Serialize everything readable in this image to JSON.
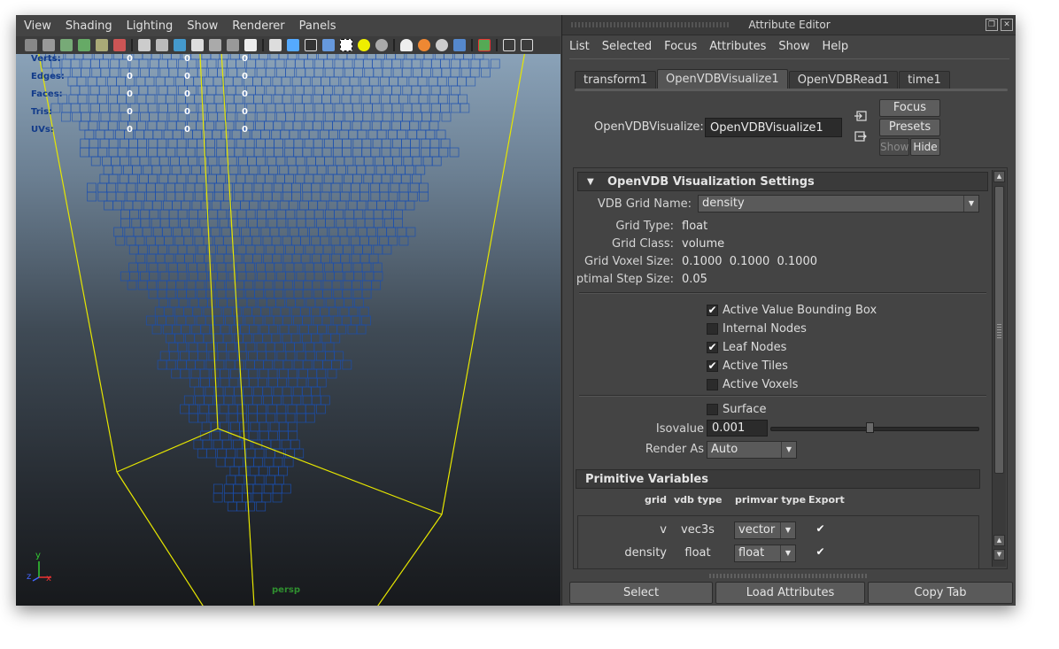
{
  "viewport": {
    "menu": [
      "View",
      "Shading",
      "Lighting",
      "Show",
      "Renderer",
      "Panels"
    ],
    "hud": [
      {
        "label": "Verts:",
        "values": [
          "0",
          "0",
          "0"
        ]
      },
      {
        "label": "Edges:",
        "values": [
          "0",
          "0",
          "0"
        ]
      },
      {
        "label": "Faces:",
        "values": [
          "0",
          "0",
          "0"
        ]
      },
      {
        "label": "Tris:",
        "values": [
          "0",
          "0",
          "0"
        ]
      },
      {
        "label": "UVs:",
        "values": [
          "0",
          "0",
          "0"
        ]
      }
    ],
    "camera_label": "persp",
    "axis": {
      "y": "y",
      "x": "x",
      "z": "z"
    }
  },
  "editor": {
    "title": "Attribute Editor",
    "menu": [
      "List",
      "Selected",
      "Focus",
      "Attributes",
      "Show",
      "Help"
    ],
    "tabs": [
      "transform1",
      "OpenVDBVisualize1",
      "OpenVDBRead1",
      "time1"
    ],
    "active_tab": "OpenVDBVisualize1",
    "node_label": "OpenVDBVisualize:",
    "node_value": "OpenVDBVisualize1",
    "buttons": {
      "focus": "Focus",
      "presets": "Presets",
      "show": "Show",
      "hide": "Hide"
    },
    "section": {
      "title": "OpenVDB Visualization Settings",
      "grid_name_label": "VDB Grid Name:",
      "grid_name_value": "density",
      "info": [
        {
          "label": "Grid Type:",
          "value": "float"
        },
        {
          "label": "Grid Class:",
          "value": "volume"
        },
        {
          "label": "Grid Voxel Size:",
          "value": "0.1000  0.1000  0.1000"
        },
        {
          "label": "ptimal Step Size:",
          "value": "0.05"
        }
      ],
      "checks": [
        {
          "label": "Active Value Bounding Box",
          "checked": true
        },
        {
          "label": "Internal Nodes",
          "checked": false
        },
        {
          "label": "Leaf Nodes",
          "checked": true
        },
        {
          "label": "Active Tiles",
          "checked": true
        },
        {
          "label": "Active Voxels",
          "checked": false
        }
      ],
      "surface_label": "Surface",
      "surface_checked": false,
      "isovalue_label": "Isovalue",
      "isovalue_value": "0.001",
      "isovalue_slider": 0.48,
      "render_as_label": "Render As",
      "render_as_value": "Auto"
    },
    "primvars": {
      "title": "Primitive Variables",
      "headers": [
        "grid",
        "vdb type",
        "primvar type",
        "Export"
      ],
      "rows": [
        {
          "grid": "v",
          "vdb_type": "vec3s",
          "primvar_type": "vector",
          "export": true
        },
        {
          "grid": "density",
          "vdb_type": "float",
          "primvar_type": "float",
          "export": true
        }
      ]
    },
    "bottom_buttons": [
      "Select",
      "Load Attributes",
      "Copy Tab"
    ]
  },
  "colors": {
    "wire": "#1a4fb0",
    "bbox": "#e6e600",
    "panel": "#444444"
  },
  "icons": [
    "checkmark-icon",
    "triangle-down-icon",
    "scroll-up-icon",
    "scroll-down-icon"
  ]
}
